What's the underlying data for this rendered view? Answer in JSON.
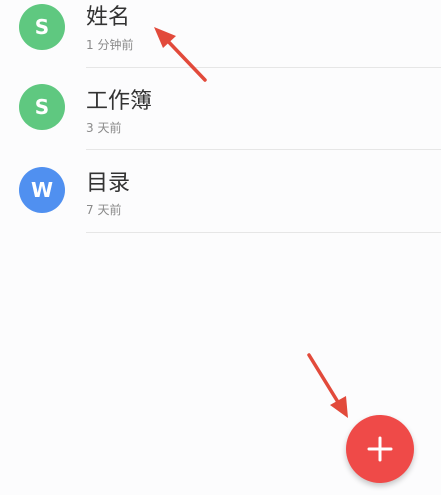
{
  "files": [
    {
      "title": "姓名",
      "time": "1 分钟前",
      "avatar_letter": "S",
      "avatar_color": "#5fc880",
      "file_type_icon": "sheet-icon"
    },
    {
      "title": "工作簿",
      "time": "3 天前",
      "avatar_letter": "S",
      "avatar_color": "#5fc880",
      "file_type_icon": "sheet-icon"
    },
    {
      "title": "目录",
      "time": "7 天前",
      "avatar_letter": "W",
      "avatar_color": "#5090f0",
      "file_type_icon": "doc-icon"
    }
  ],
  "fab": {
    "icon": "plus-icon",
    "color": "#ef4a48"
  },
  "annotation_color": "#e24a3b"
}
